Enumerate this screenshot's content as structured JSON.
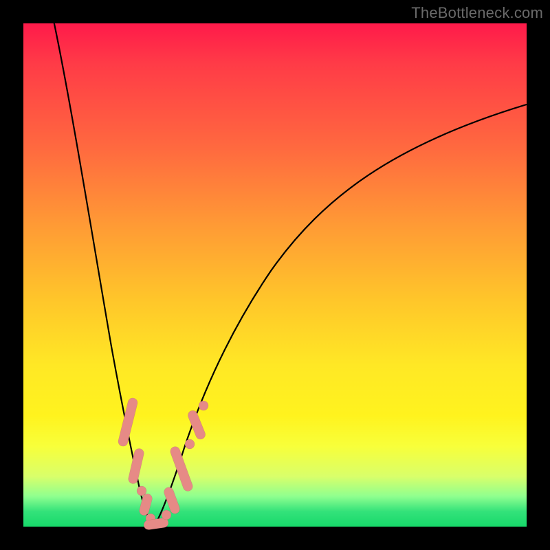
{
  "watermark": "TheBottleneck.com",
  "colors": {
    "marker": "#e68a86",
    "curve": "#000000",
    "frame": "#000000"
  },
  "chart_data": {
    "type": "line",
    "title": "",
    "xlabel": "",
    "ylabel": "",
    "xlim": [
      0,
      100
    ],
    "ylim": [
      0,
      100
    ],
    "grid": false,
    "legend": false,
    "series": [
      {
        "name": "left-branch",
        "x": [
          6,
          8,
          10,
          12,
          14,
          16,
          18,
          19,
          20,
          21,
          22,
          23
        ],
        "y": [
          100,
          83,
          67,
          52,
          38,
          26,
          15,
          10,
          6,
          3,
          1,
          0
        ]
      },
      {
        "name": "right-branch",
        "x": [
          23,
          25,
          28,
          32,
          36,
          42,
          50,
          58,
          66,
          76,
          88,
          100
        ],
        "y": [
          0,
          3,
          9,
          18,
          27,
          38,
          50,
          58,
          65,
          72,
          79,
          84
        ]
      }
    ],
    "highlighted_ranges": [
      {
        "branch": "left-branch",
        "x_from": 18.6,
        "x_to": 21.2
      },
      {
        "branch": "left-branch",
        "x_from": 21.6,
        "x_to": 22.6
      },
      {
        "branch": "left-branch",
        "x_from": 22.8,
        "x_to": 23.0
      },
      {
        "branch": "right-branch",
        "x_from": 23.0,
        "x_to": 26.0
      },
      {
        "branch": "right-branch",
        "x_from": 26.8,
        "x_to": 28.6
      },
      {
        "branch": "right-branch",
        "x_from": 29.2,
        "x_to": 30.0
      }
    ]
  }
}
